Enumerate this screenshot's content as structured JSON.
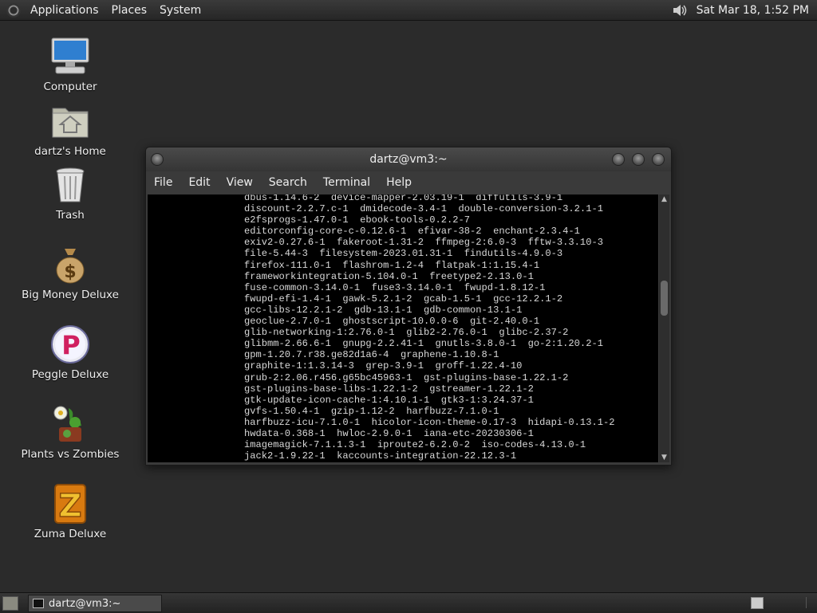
{
  "top_panel": {
    "menus": [
      "Applications",
      "Places",
      "System"
    ],
    "clock": "Sat Mar 18,  1:52 PM"
  },
  "desktop_icons": [
    {
      "label": "Computer",
      "icon": "computer-icon"
    },
    {
      "label": "dartz's Home",
      "icon": "home-folder-icon"
    },
    {
      "label": "Trash",
      "icon": "trash-icon"
    },
    {
      "label": "Big Money Deluxe",
      "icon": "money-bag-icon"
    },
    {
      "label": "Peggle Deluxe",
      "icon": "peggle-icon"
    },
    {
      "label": "Plants vs Zombies",
      "icon": "plants-vs-zombies-icon"
    },
    {
      "label": "Zuma Deluxe",
      "icon": "zuma-icon"
    }
  ],
  "terminal": {
    "title": "dartz@vm3:~",
    "menus": [
      "File",
      "Edit",
      "View",
      "Search",
      "Terminal",
      "Help"
    ],
    "output": "dbus-1.14.6-2  device-mapper-2.03.19-1  diffutils-3.9-1\ndiscount-2.2.7.c-1  dmidecode-3.4-1  double-conversion-3.2.1-1\ne2fsprogs-1.47.0-1  ebook-tools-0.2.2-7\neditorconfig-core-c-0.12.6-1  efivar-38-2  enchant-2.3.4-1\nexiv2-0.27.6-1  fakeroot-1.31-2  ffmpeg-2:6.0-3  fftw-3.3.10-3\nfile-5.44-3  filesystem-2023.01.31-1  findutils-4.9.0-3\nfirefox-111.0-1  flashrom-1.2-4  flatpak-1:1.15.4-1\nframeworkintegration-5.104.0-1  freetype2-2.13.0-1\nfuse-common-3.14.0-1  fuse3-3.14.0-1  fwupd-1.8.12-1\nfwupd-efi-1.4-1  gawk-5.2.1-2  gcab-1.5-1  gcc-12.2.1-2\ngcc-libs-12.2.1-2  gdb-13.1-1  gdb-common-13.1-1\ngeoclue-2.7.0-1  ghostscript-10.0.0-6  git-2.40.0-1\nglib-networking-1:2.76.0-1  glib2-2.76.0-1  glibc-2.37-2\nglibmm-2.66.6-1  gnupg-2.2.41-1  gnutls-3.8.0-1  go-2:1.20.2-1\ngpm-1.20.7.r38.ge82d1a6-4  graphene-1.10.8-1\ngraphite-1:1.3.14-3  grep-3.9-1  groff-1.22.4-10\ngrub-2:2.06.r456.g65bc45963-1  gst-plugins-base-1.22.1-2\ngst-plugins-base-libs-1.22.1-2  gstreamer-1.22.1-2\ngtk-update-icon-cache-1:4.10.1-1  gtk3-1:3.24.37-1\ngvfs-1.50.4-1  gzip-1.12-2  harfbuzz-7.1.0-1\nharfbuzz-icu-7.1.0-1  hicolor-icon-theme-0.17-3  hidapi-0.13.1-2\nhwdata-0.368-1  hwloc-2.9.0-1  iana-etc-20230306-1\nimagemagick-7.1.1.3-1  iproute2-6.2.0-2  iso-codes-4.13.0-1\njack2-1.9.22-1  kaccounts-integration-22.12.3-1"
  },
  "bottom_panel": {
    "task_label": "dartz@vm3:~"
  }
}
